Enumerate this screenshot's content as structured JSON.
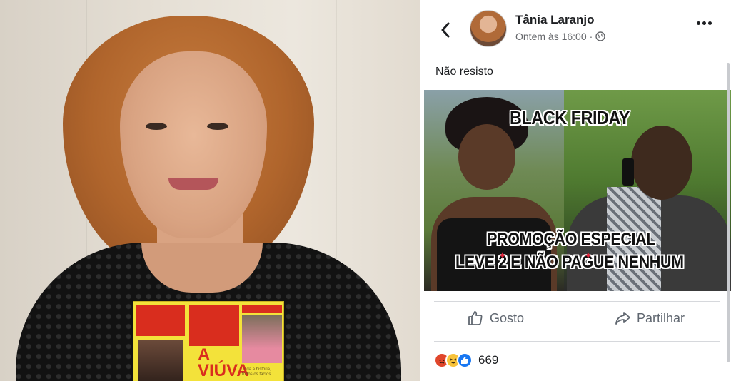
{
  "post": {
    "author_name": "Tânia Laranjo",
    "timestamp": "Ontem às 16:00",
    "separator": "·",
    "privacy_icon": "globe-icon",
    "caption": "Não resisto",
    "meme": {
      "title": "BLACK FRIDAY",
      "line1": "PROMOÇÃO ESPECIAL",
      "line2": "LEVE  2 E NÃO PAGUE NENHUM"
    },
    "actions": {
      "like_label": "Gosto",
      "share_label": "Partilhar"
    },
    "reactions": {
      "types": [
        "angry",
        "haha",
        "like"
      ],
      "count": "669"
    }
  },
  "book": {
    "title_line1": "A",
    "title_line2": "VIÚVA",
    "blurb": "Toda a história, todos os factos"
  },
  "colors": {
    "facebook_blue": "#1877f2",
    "text_primary": "#1c1e21",
    "text_secondary": "#65676b",
    "book_yellow": "#f3e23a",
    "book_red": "#d92d1e"
  }
}
